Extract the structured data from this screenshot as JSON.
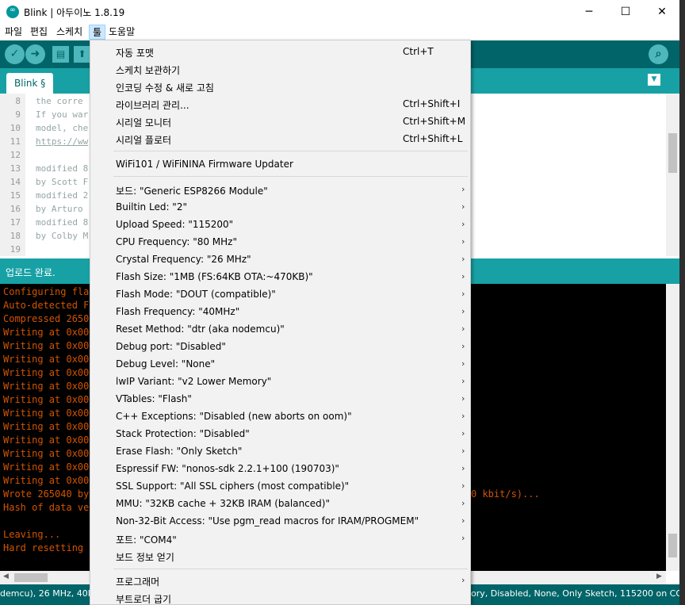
{
  "window": {
    "title": "Blink | 아두이노 1.8.19",
    "min_glyph": "─",
    "max_glyph": "☐",
    "close_glyph": "✕"
  },
  "menubar": [
    "파일",
    "편집",
    "스케치",
    "툴",
    "도움말"
  ],
  "toolbar": {
    "verify_icon": "check-icon",
    "upload_icon": "arrow-right-icon",
    "new_icon": "file-icon",
    "open_icon": "upload-arrow-icon",
    "serial_icon": "magnifier-icon",
    "accent": "#006468",
    "button_color": "#4db7bb"
  },
  "tab": {
    "label": "Blink §",
    "menu_glyph": "▼"
  },
  "editor": {
    "line_numbers": [
      "8",
      "9",
      "10",
      "11",
      "12",
      "13",
      "14",
      "15",
      "16",
      "17",
      "18",
      "19"
    ],
    "lines": [
      "the corre",
      "If you war",
      "model, che",
      "https://ww",
      "",
      "modified 8",
      "by Scott F",
      "modified 2",
      "by Arturo",
      "modified 8",
      "by Colby M",
      ""
    ]
  },
  "status": {
    "text": "업로드 완료."
  },
  "console": {
    "lines": [
      "Configuring fla",
      "Auto-detected F",
      "Compressed 2650",
      "Writing at 0x00",
      "Writing at 0x00",
      "Writing at 0x00",
      "Writing at 0x00",
      "Writing at 0x00",
      "Writing at 0x00",
      "Writing at 0x00",
      "Writing at 0x00",
      "Writing at 0x00",
      "Writing at 0x00",
      "Writing at 0x00",
      "Writing at 0x00",
      "Wrote 265040 by",
      "Hash of data ve",
      "",
      "Leaving...",
      "Hard resetting v"
    ],
    "rate_text": "0 kbit/s)...",
    "text_color": "#d35400"
  },
  "bottom_status": {
    "left": "demcu), 26 MHz, 40MH",
    "right": "ory, Disabled, None, Only Sketch, 115200 on COM4"
  },
  "tools_menu": {
    "group1": [
      {
        "label": "자동 포맷",
        "shortcut": "Ctrl+T"
      },
      {
        "label": "스케치 보관하기",
        "shortcut": ""
      },
      {
        "label": "인코딩 수정 & 새로 고침",
        "shortcut": ""
      },
      {
        "label": "라이브러리 관리...",
        "shortcut": "Ctrl+Shift+I"
      },
      {
        "label": "시리얼 모니터",
        "shortcut": "Ctrl+Shift+M"
      },
      {
        "label": "시리얼 플로터",
        "shortcut": "Ctrl+Shift+L"
      }
    ],
    "group2": [
      {
        "label": "WiFi101 / WiFiNINA Firmware Updater"
      }
    ],
    "group3": [
      {
        "label": "보드: \"Generic ESP8266 Module\"",
        "submenu": true
      },
      {
        "label": "Builtin Led: \"2\"",
        "submenu": true
      },
      {
        "label": "Upload Speed: \"115200\"",
        "submenu": true
      },
      {
        "label": "CPU Frequency: \"80 MHz\"",
        "submenu": true
      },
      {
        "label": "Crystal Frequency: \"26 MHz\"",
        "submenu": true
      },
      {
        "label": "Flash Size: \"1MB (FS:64KB OTA:~470KB)\"",
        "submenu": true
      },
      {
        "label": "Flash Mode: \"DOUT (compatible)\"",
        "submenu": true
      },
      {
        "label": "Flash Frequency: \"40MHz\"",
        "submenu": true
      },
      {
        "label": "Reset Method: \"dtr (aka nodemcu)\"",
        "submenu": true
      },
      {
        "label": "Debug port: \"Disabled\"",
        "submenu": true
      },
      {
        "label": "Debug Level: \"None\"",
        "submenu": true
      },
      {
        "label": "lwIP Variant: \"v2 Lower Memory\"",
        "submenu": true
      },
      {
        "label": "VTables: \"Flash\"",
        "submenu": true
      },
      {
        "label": "C++ Exceptions: \"Disabled (new aborts on oom)\"",
        "submenu": true
      },
      {
        "label": "Stack Protection: \"Disabled\"",
        "submenu": true
      },
      {
        "label": "Erase Flash: \"Only Sketch\"",
        "submenu": true
      },
      {
        "label": "Espressif FW: \"nonos-sdk 2.2.1+100 (190703)\"",
        "submenu": true
      },
      {
        "label": "SSL Support: \"All SSL ciphers (most compatible)\"",
        "submenu": true
      },
      {
        "label": "MMU: \"32KB cache + 32KB IRAM (balanced)\"",
        "submenu": true
      },
      {
        "label": "Non-32-Bit Access: \"Use pgm_read macros for IRAM/PROGMEM\"",
        "submenu": true
      },
      {
        "label": "포트: \"COM4\"",
        "submenu": true
      },
      {
        "label": "보드 정보 얻기",
        "submenu": false
      }
    ],
    "group4": [
      {
        "label": "프로그래머",
        "submenu": true
      },
      {
        "label": "부트로더 굽기",
        "submenu": false
      }
    ],
    "submenu_glyph": "›"
  }
}
